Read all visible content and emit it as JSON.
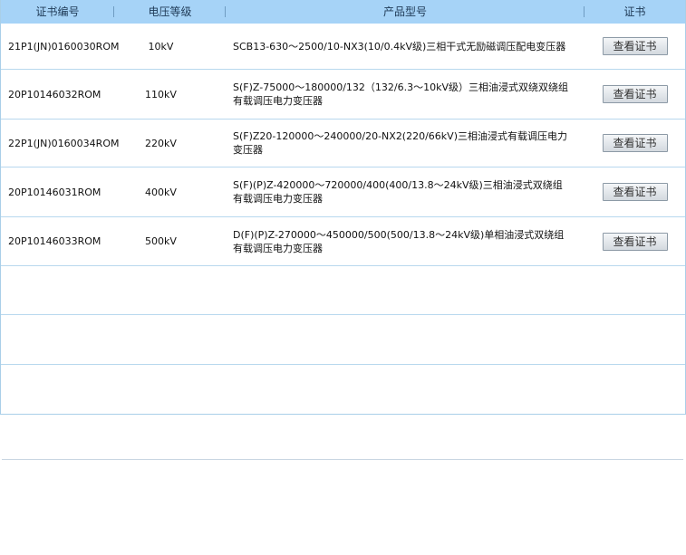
{
  "columns": {
    "code": "证书编号",
    "voltage": "电压等级",
    "model": "产品型号",
    "cert": "证书"
  },
  "rows": [
    {
      "code": "21P1(JN)0160030ROM",
      "voltage": "10kV",
      "model": "SCB13-630～2500/10-NX3(10/0.4kV级)三相干式无励磁调压配电变压器",
      "button": "查看证书"
    },
    {
      "code": "20P10146032ROM",
      "voltage": "110kV",
      "model": "S(F)Z-75000～180000/132（132/6.3～10kV级）三相油浸式双绕双绕组有载调压电力变压器",
      "button": "查看证书"
    },
    {
      "code": "22P1(JN)0160034ROM",
      "voltage": "220kV",
      "model": "S(F)Z20-120000～240000/20-NX2(220/66kV)三相油浸式有载调压电力变压器",
      "button": "查看证书"
    },
    {
      "code": "20P10146031ROM",
      "voltage": "400kV",
      "model": "S(F)(P)Z-420000～720000/400(400/13.8～24kV级)三相油浸式双绕组有载调压电力变压器",
      "button": "查看证书"
    },
    {
      "code": "20P10146033ROM",
      "voltage": "500kV",
      "model": "D(F)(P)Z-270000～450000/500(500/13.8～24kV级)单相油浸式双绕组有载调压电力变压器",
      "button": "查看证书"
    }
  ]
}
